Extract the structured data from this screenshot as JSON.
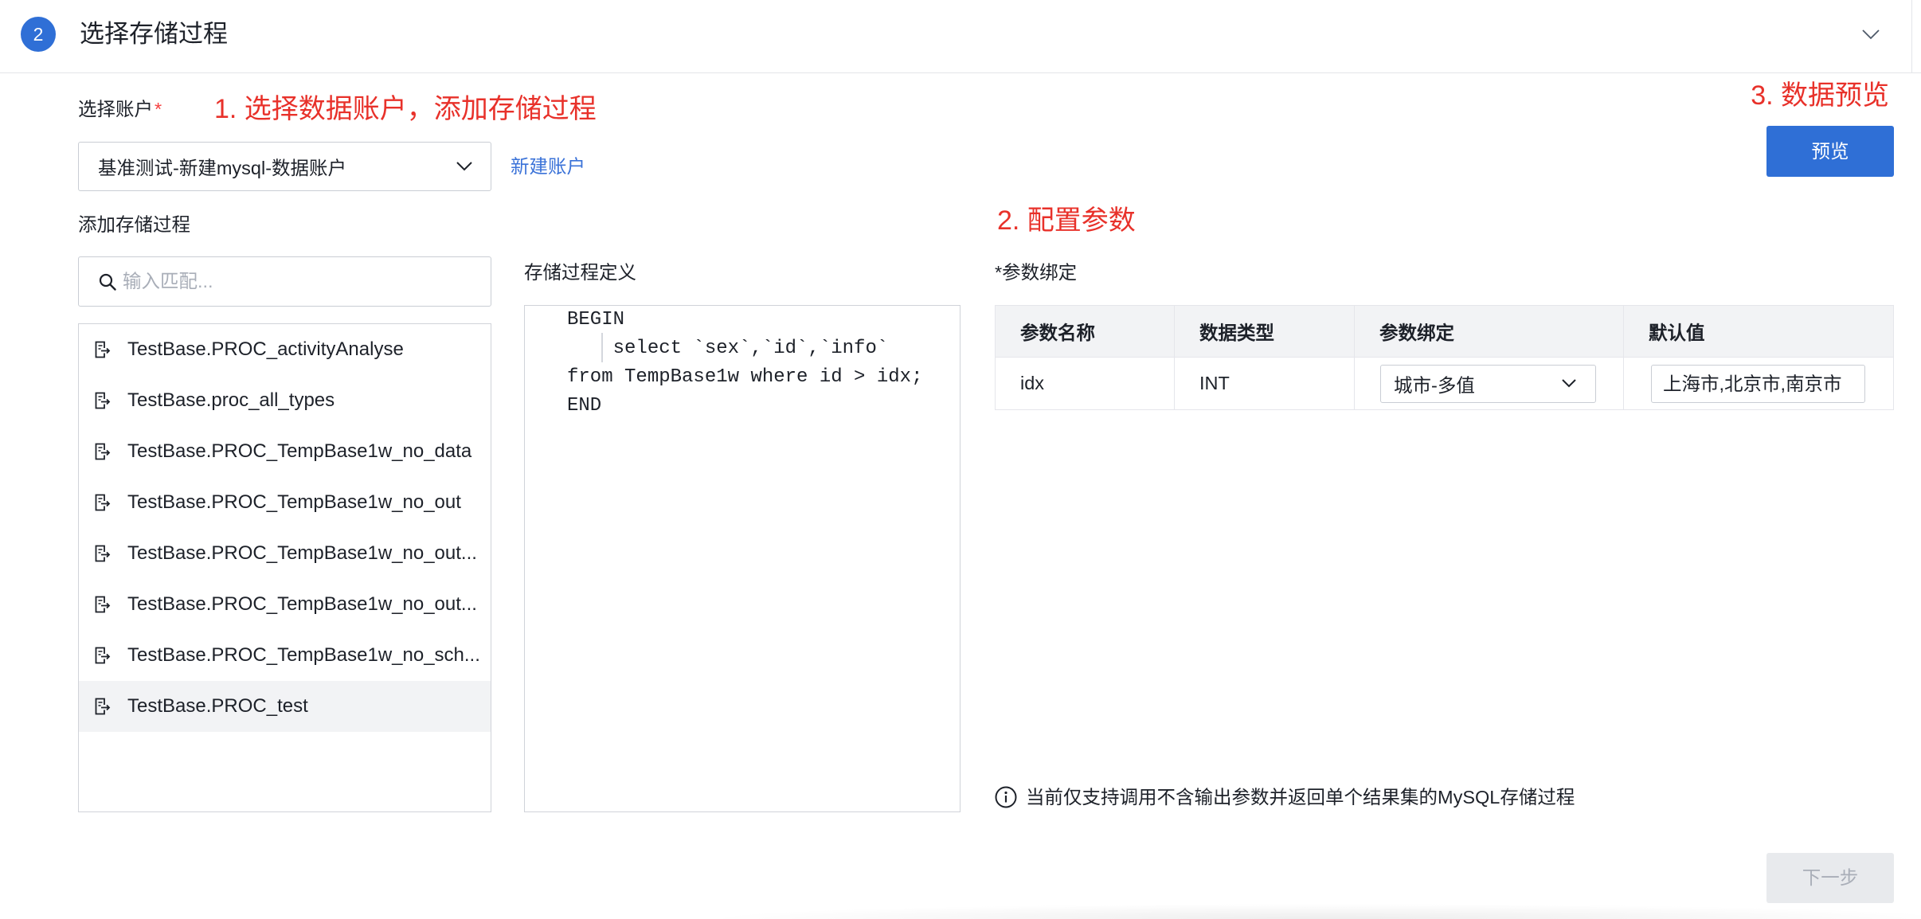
{
  "header": {
    "step_number": "2",
    "title": "选择存储过程",
    "collapse_icon": "chevron-down-icon"
  },
  "annotations": {
    "step1": "1. 选择数据账户，添加存储过程",
    "step2": "2. 配置参数",
    "step3": "3. 数据预览"
  },
  "account": {
    "label": "选择账户",
    "required_mark": "*",
    "selected": "基准测试-新建mysql-数据账户",
    "new_account_link": "新建账户"
  },
  "procedures": {
    "label": "添加存储过程",
    "search_placeholder": "输入匹配...",
    "search_icon": "search-icon",
    "item_icon": "procedure-icon",
    "items": [
      {
        "name": "TestBase.PROC_activityAnalyse",
        "selected": false
      },
      {
        "name": "TestBase.proc_all_types",
        "selected": false
      },
      {
        "name": "TestBase.PROC_TempBase1w_no_data",
        "selected": false
      },
      {
        "name": "TestBase.PROC_TempBase1w_no_out",
        "selected": false
      },
      {
        "name": "TestBase.PROC_TempBase1w_no_out...",
        "selected": false
      },
      {
        "name": "TestBase.PROC_TempBase1w_no_out...",
        "selected": false
      },
      {
        "name": "TestBase.PROC_TempBase1w_no_sch...",
        "selected": false
      },
      {
        "name": "TestBase.PROC_test",
        "selected": true
      }
    ]
  },
  "definition": {
    "label": "存储过程定义",
    "code_lines": [
      "BEGIN",
      "    select `sex`,`id`,`info`",
      "from TempBase1w where id > idx;",
      "END"
    ]
  },
  "params": {
    "label": "*参数绑定",
    "columns": [
      "参数名称",
      "数据类型",
      "参数绑定",
      "默认值"
    ],
    "rows": [
      {
        "name": "idx",
        "type": "INT",
        "binding": "城市-多值",
        "default": "上海市,北京市,南京市"
      }
    ]
  },
  "notice": {
    "icon": "info-icon",
    "text": "当前仅支持调用不含输出参数并返回单个结果集的MySQL存储过程"
  },
  "buttons": {
    "preview": "预览",
    "next": "下一步",
    "next_disabled": true
  },
  "colors": {
    "accent": "#2f6fd6",
    "annotation": "#e8312a",
    "link": "#3a72d8",
    "required": "#f53f3f",
    "selected_row_bg": "#f2f3f5",
    "table_header_bg": "#f2f3f5",
    "disabled_bg": "#e8eaed",
    "disabled_text": "#a9aeb8"
  }
}
